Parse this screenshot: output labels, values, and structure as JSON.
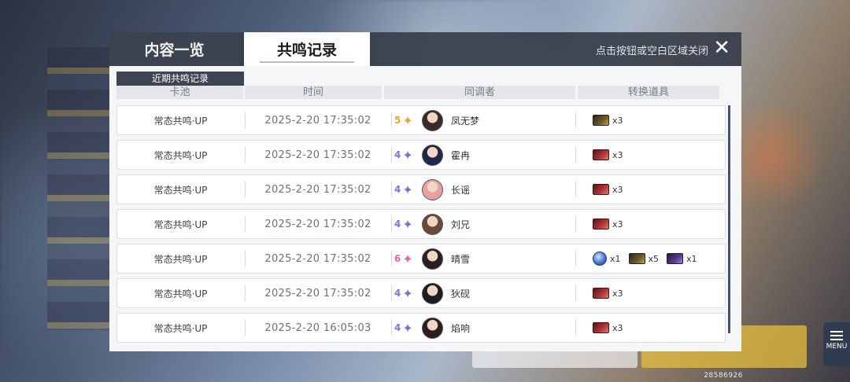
{
  "tabs": [
    {
      "label": "内容一览",
      "active": false
    },
    {
      "label": "共鸣记录",
      "active": true
    }
  ],
  "close_hint": "点击按钮或空白区域关闭",
  "section_label": "近期共鸣记录",
  "columns": [
    "卡池",
    "时间",
    "同调者",
    "转换道具"
  ],
  "rows": [
    {
      "pool": "常态共鸣·UP",
      "time": "2025-2-20  17:35:02",
      "rarity": "5",
      "rarity_color": "#e8a43a",
      "name": "凤无梦",
      "avatar_color": "#3a2a2a",
      "items": [
        {
          "icon": "gold-ticket-icon",
          "qty": "x3"
        }
      ]
    },
    {
      "pool": "常态共鸣·UP",
      "time": "2025-2-20  17:35:02",
      "rarity": "4",
      "rarity_color": "#8a6cd8",
      "name": "霍冉",
      "avatar_color": "#20264a",
      "items": [
        {
          "icon": "red-ticket-icon",
          "qty": "x3"
        }
      ]
    },
    {
      "pool": "常态共鸣·UP",
      "time": "2025-2-20  17:35:02",
      "rarity": "4",
      "rarity_color": "#8a6cd8",
      "name": "长谣",
      "avatar_color": "#e8a0a0",
      "items": [
        {
          "icon": "red-ticket-icon",
          "qty": "x3"
        }
      ]
    },
    {
      "pool": "常态共鸣·UP",
      "time": "2025-2-20  17:35:02",
      "rarity": "4",
      "rarity_color": "#8a6cd8",
      "name": "刘兄",
      "avatar_color": "#6a4a36",
      "items": [
        {
          "icon": "red-ticket-icon",
          "qty": "x3"
        }
      ]
    },
    {
      "pool": "常态共鸣·UP",
      "time": "2025-2-20  17:35:02",
      "rarity": "6",
      "rarity_color": "#e06aa8",
      "name": "晴雪",
      "avatar_color": "#2a1e22",
      "items": [
        {
          "icon": "blue-orb-icon",
          "qty": "x1"
        },
        {
          "icon": "gold-ticket-icon",
          "qty": "x5"
        },
        {
          "icon": "purple-ticket-icon",
          "qty": "x1"
        }
      ]
    },
    {
      "pool": "常态共鸣·UP",
      "time": "2025-2-20  17:35:02",
      "rarity": "4",
      "rarity_color": "#8a6cd8",
      "name": "狄砚",
      "avatar_color": "#1c1c24",
      "items": [
        {
          "icon": "red-ticket-icon",
          "qty": "x3"
        }
      ]
    },
    {
      "pool": "常态共鸣·UP",
      "time": "2025-2-20  16:05:03",
      "rarity": "4",
      "rarity_color": "#8a6cd8",
      "name": "焰响",
      "avatar_color": "#2a1e1e",
      "items": [
        {
          "icon": "red-ticket-icon",
          "qty": "x3"
        }
      ]
    }
  ],
  "menu_label": "MENU",
  "uid": "28586926"
}
